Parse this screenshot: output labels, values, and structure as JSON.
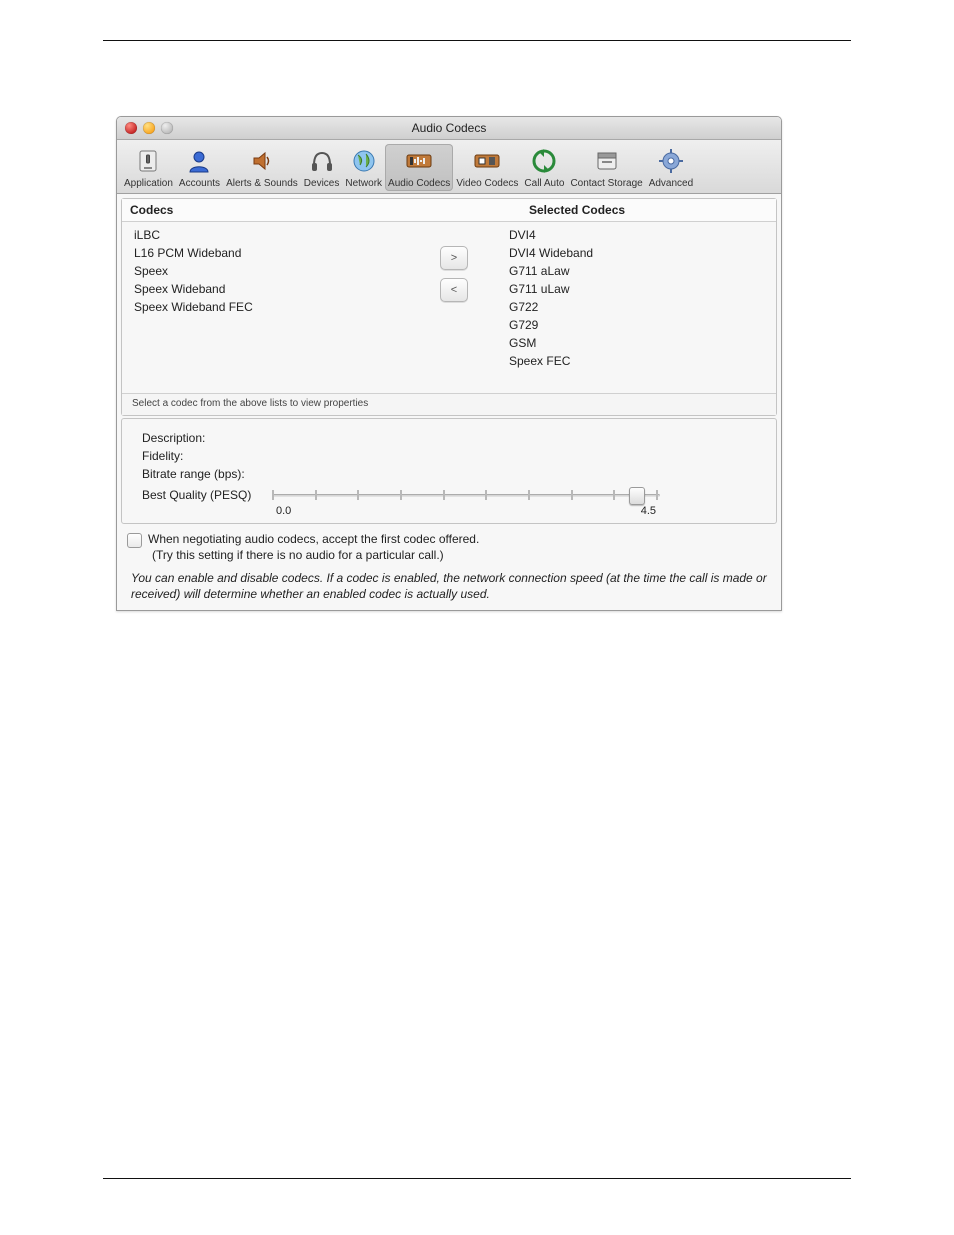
{
  "window": {
    "title": "Audio Codecs"
  },
  "toolbar": {
    "items": [
      {
        "name": "application",
        "label": "Application",
        "icon": "app"
      },
      {
        "name": "accounts",
        "label": "Accounts",
        "icon": "person"
      },
      {
        "name": "alerts",
        "label": "Alerts & Sounds",
        "icon": "speaker"
      },
      {
        "name": "devices",
        "label": "Devices",
        "icon": "headphones"
      },
      {
        "name": "network",
        "label": "Network",
        "icon": "globe"
      },
      {
        "name": "audio-codecs",
        "label": "Audio Codecs",
        "icon": "audio",
        "selected": true
      },
      {
        "name": "video-codecs",
        "label": "Video Codecs",
        "icon": "video"
      },
      {
        "name": "call-auto",
        "label": "Call Auto",
        "icon": "auto"
      },
      {
        "name": "contact-storage",
        "label": "Contact Storage",
        "icon": "storage"
      },
      {
        "name": "advanced",
        "label": "Advanced",
        "icon": "gear"
      }
    ]
  },
  "codec_lists": {
    "available_header": "Codecs",
    "selected_header": "Selected Codecs",
    "available": [
      "iLBC",
      "L16 PCM Wideband",
      "Speex",
      "Speex Wideband",
      "Speex Wideband FEC"
    ],
    "selected": [
      "DVI4",
      "DVI4 Wideband",
      "G711 aLaw",
      "G711 uLaw",
      "G722",
      "G729",
      "GSM",
      "Speex FEC"
    ],
    "hint": "Select a codec from the above lists to view properties"
  },
  "properties": {
    "description_label": "Description:",
    "fidelity_label": "Fidelity:",
    "bitrate_label": "Bitrate range (bps):",
    "quality_label": "Best Quality (PESQ)",
    "quality_min": "0.0",
    "quality_max": "4.5"
  },
  "checkbox": {
    "label": "When negotiating audio codecs, accept the first codec offered.",
    "sub": "(Try this setting if there is no audio for a particular call.)"
  },
  "footer_note": "You can enable and disable codecs. If a codec is enabled, the network connection speed (at the time the call is made or received) will determine whether an enabled codec is actually used."
}
